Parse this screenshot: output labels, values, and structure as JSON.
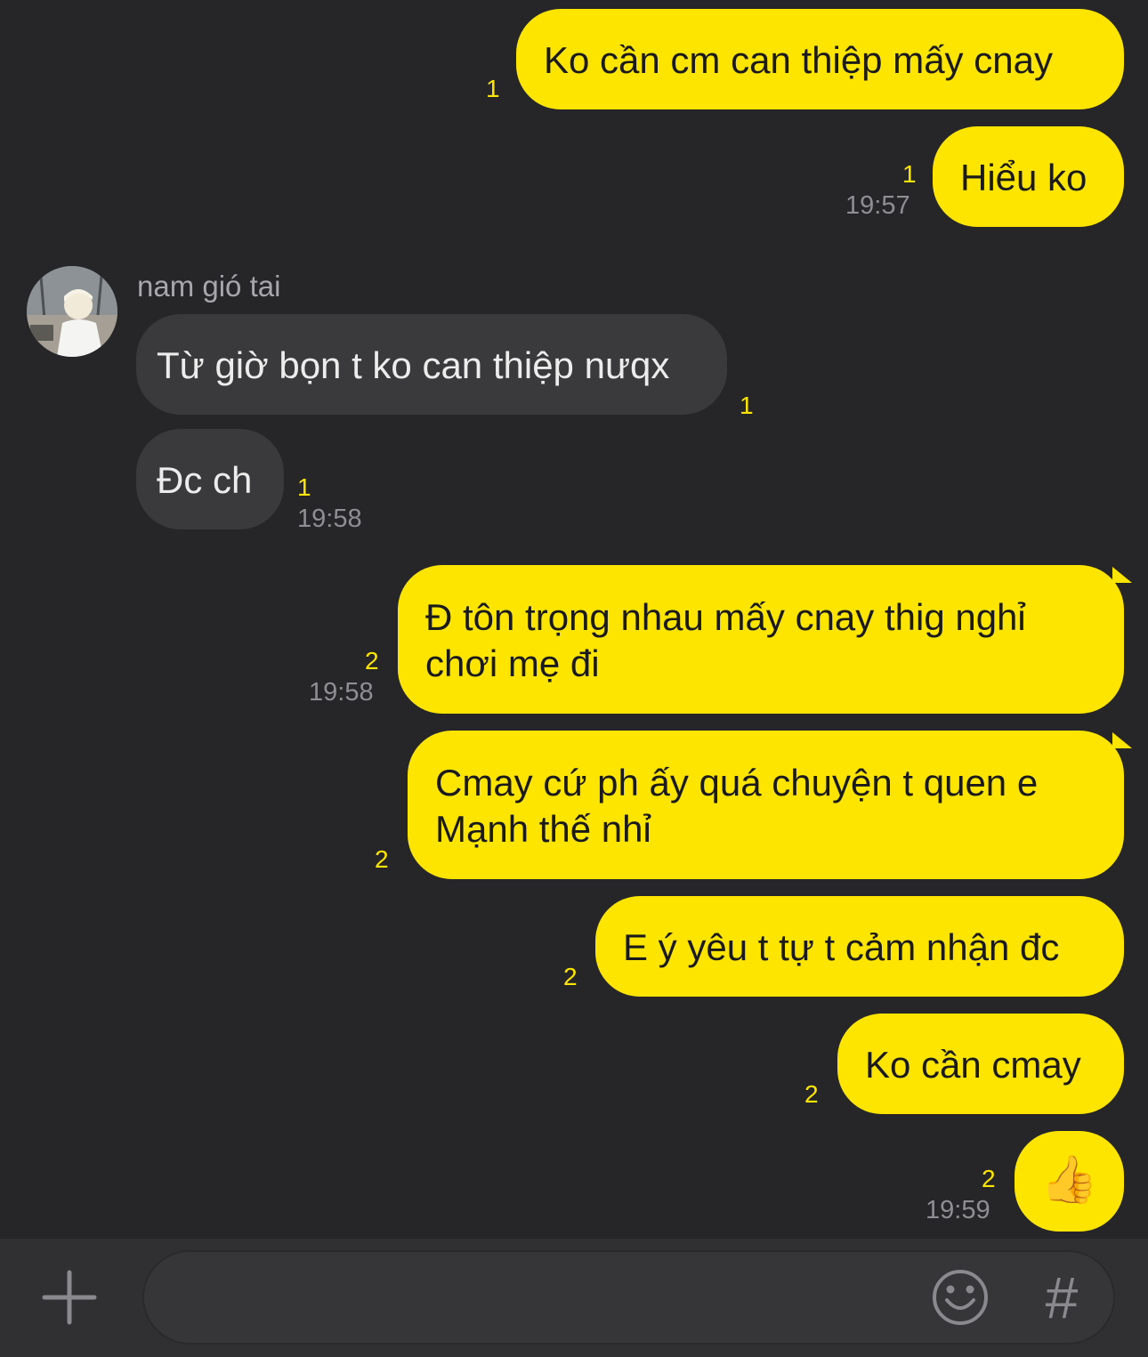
{
  "colors": {
    "background": "#262628",
    "outgoing_bubble": "#fee500",
    "incoming_bubble": "#3a3a3c",
    "unread_count": "#fee500",
    "timestamp": "#8e8e93"
  },
  "messages": [
    {
      "direction": "outgoing",
      "text": "Ko cần cm can thiệp mấy cnay",
      "unread": "1"
    },
    {
      "direction": "outgoing",
      "text": "Hiểu ko",
      "unread": "1",
      "time": "19:57"
    },
    {
      "direction": "incoming",
      "sender": "nam gió tai",
      "text": "Từ giờ bọn t ko can thiệp nưqx",
      "unread": "1"
    },
    {
      "direction": "incoming",
      "text": "Đc ch",
      "unread": "1",
      "time": "19:58"
    },
    {
      "direction": "outgoing",
      "text": "Đ tôn trọng nhau mấy cnay thig nghỉ chơi mẹ đi",
      "unread": "2",
      "time": "19:58"
    },
    {
      "direction": "outgoing",
      "text": "Cmay cứ ph ấy quá chuyện t quen e Mạnh thế nhỉ",
      "unread": "2"
    },
    {
      "direction": "outgoing",
      "text": "E ý yêu t tự t cảm nhận đc",
      "unread": "2"
    },
    {
      "direction": "outgoing",
      "text": "Ko cần cmay",
      "unread": "2"
    },
    {
      "direction": "outgoing",
      "text": "👍",
      "unread": "2",
      "time": "19:59"
    }
  ],
  "composer": {
    "add_icon": "plus-icon",
    "input_value": "",
    "emoji_icon": "smiley-icon",
    "hashtag_icon": "hashtag-icon",
    "hashtag_glyph": "#"
  }
}
